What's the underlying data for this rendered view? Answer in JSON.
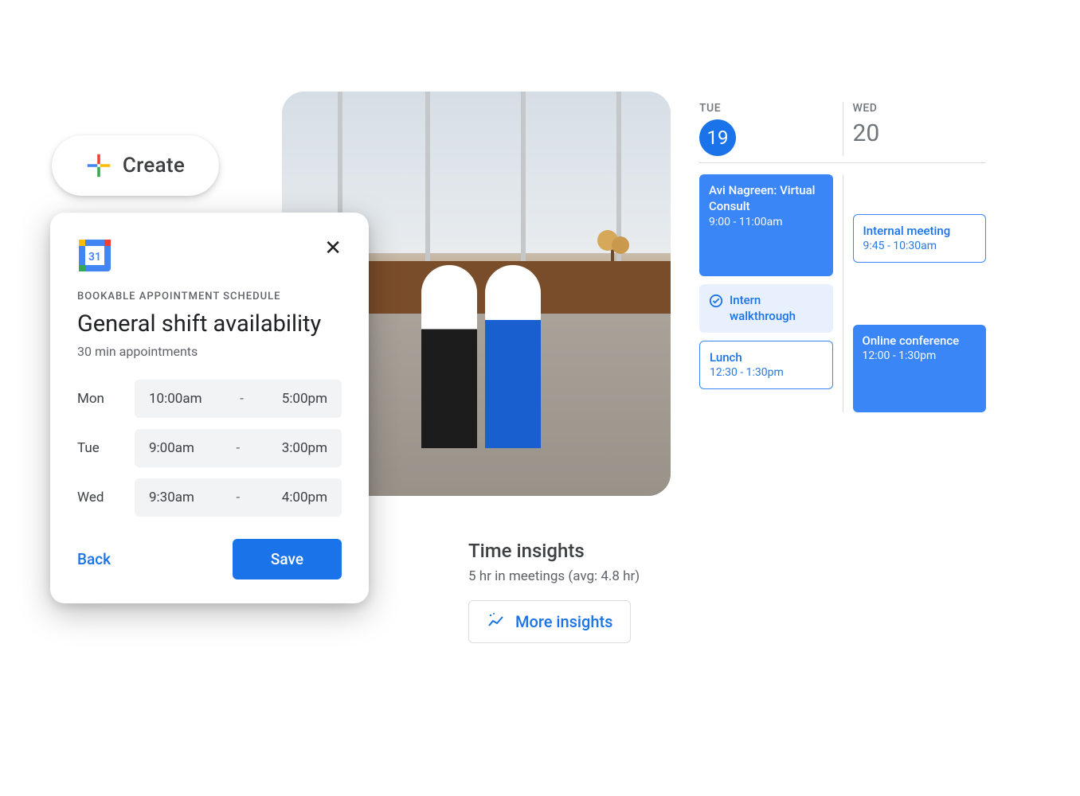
{
  "create": {
    "label": "Create"
  },
  "appointment": {
    "overline": "BOOKABLE APPOINTMENT SCHEDULE",
    "title": "General shift availability",
    "subtitle": "30 min appointments",
    "rows": [
      {
        "day": "Mon",
        "start": "10:00am",
        "end": "5:00pm"
      },
      {
        "day": "Tue",
        "start": "9:00am",
        "end": "3:00pm"
      },
      {
        "day": "Wed",
        "start": "9:30am",
        "end": "4:00pm"
      }
    ],
    "back": "Back",
    "save": "Save"
  },
  "insights": {
    "title": "Time insights",
    "subtitle": "5 hr in meetings (avg: 4.8 hr)",
    "more": "More insights"
  },
  "calendar": {
    "days": [
      {
        "dow": "TUE",
        "num": "19",
        "selected": true
      },
      {
        "dow": "WED",
        "num": "20",
        "selected": false
      }
    ],
    "columns": [
      [
        {
          "style": "solid",
          "title": "Avi Nagreen: Virtual Consult",
          "time": "9:00 - 11:00am",
          "height": 128
        },
        {
          "style": "pale",
          "title": "Intern walkthrough",
          "icon": true
        },
        {
          "style": "outline",
          "title": "Lunch",
          "time": "12:30 - 1:30pm"
        }
      ],
      [
        {
          "style": "outline",
          "title": "Internal meeting",
          "time": "9:45 - 10:30am"
        },
        {
          "style": "solid",
          "title": "Online conference",
          "time": "12:00 - 1:30pm",
          "height": 110
        }
      ]
    ]
  }
}
